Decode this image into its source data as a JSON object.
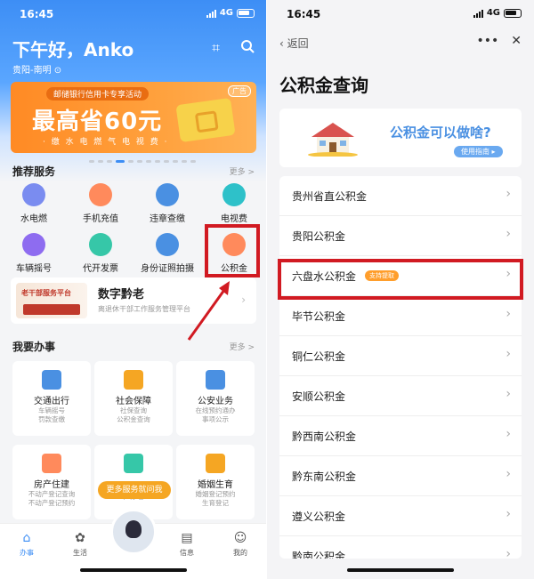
{
  "left": {
    "status": {
      "time": "16:45",
      "network": "4G"
    },
    "greeting": "下午好，Anko",
    "location": "贵阳-南明",
    "banner": {
      "tag": "邮储银行信用卡专享活动",
      "ad": "广告",
      "headline": "最高省60元",
      "subline": "· 缴 水 电 燃 气 电 视 费 ·"
    },
    "recommended": {
      "title": "推荐服务",
      "more": "更多 >",
      "items": [
        {
          "label": "水电燃",
          "color": "#7a8cf0"
        },
        {
          "label": "手机充值",
          "color": "#ff8a5c"
        },
        {
          "label": "违章查缴",
          "color": "#4a90e2"
        },
        {
          "label": "电视费",
          "color": "#2ec1c9"
        },
        {
          "label": "车辆摇号",
          "color": "#8e6cf0"
        },
        {
          "label": "代开发票",
          "color": "#36c7a8"
        },
        {
          "label": "身份证照拍摄",
          "color": "#4a90e2"
        },
        {
          "label": "公积金",
          "color": "#ff8a5c"
        }
      ]
    },
    "digital": {
      "logo_text": "老干部服务平台",
      "title": "数字黔老",
      "subtitle": "离退休干部工作服务管理平台"
    },
    "affairs": {
      "title": "我要办事",
      "more": "更多 >",
      "cards": [
        {
          "title": "交通出行",
          "line1": "车辆摇号",
          "line2": "罚款查缴",
          "color": "#4a90e2"
        },
        {
          "title": "社会保障",
          "line1": "社保查询",
          "line2": "公积金查询",
          "color": "#f5a623"
        },
        {
          "title": "公安业务",
          "line1": "在线预约通办",
          "line2": "事项公示",
          "color": "#4a90e2"
        },
        {
          "title": "房产住建",
          "line1": "不动产登记查询",
          "line2": "不动产登记预约",
          "color": "#ff8a5c"
        },
        {
          "title": "",
          "line1": "",
          "line2": "户办理",
          "color": "#36c7a8"
        },
        {
          "title": "婚姻生育",
          "line1": "婚姻登记预约",
          "line2": "生育登记",
          "color": "#f5a623"
        }
      ],
      "more_button": "更多服务就问我"
    },
    "tabs": [
      {
        "label": "办事",
        "icon": "home-icon"
      },
      {
        "label": "生活",
        "icon": "leaf-icon"
      },
      {
        "label": "信息",
        "icon": "document-icon"
      },
      {
        "label": "我的",
        "icon": "person-icon"
      }
    ]
  },
  "right": {
    "status": {
      "time": "16:45",
      "network": "4G"
    },
    "back": "返回",
    "title": "公积金查询",
    "promo": {
      "text": "公积金可以做啥?",
      "button": "使用指南 ▸"
    },
    "items": [
      {
        "label": "贵州省直公积金",
        "badge": ""
      },
      {
        "label": "贵阳公积金",
        "badge": ""
      },
      {
        "label": "六盘水公积金",
        "badge": "支持提取"
      },
      {
        "label": "毕节公积金",
        "badge": ""
      },
      {
        "label": "铜仁公积金",
        "badge": ""
      },
      {
        "label": "安顺公积金",
        "badge": ""
      },
      {
        "label": "黔西南公积金",
        "badge": ""
      },
      {
        "label": "黔东南公积金",
        "badge": ""
      },
      {
        "label": "遵义公积金",
        "badge": ""
      },
      {
        "label": "黔南公积金",
        "badge": ""
      }
    ]
  }
}
